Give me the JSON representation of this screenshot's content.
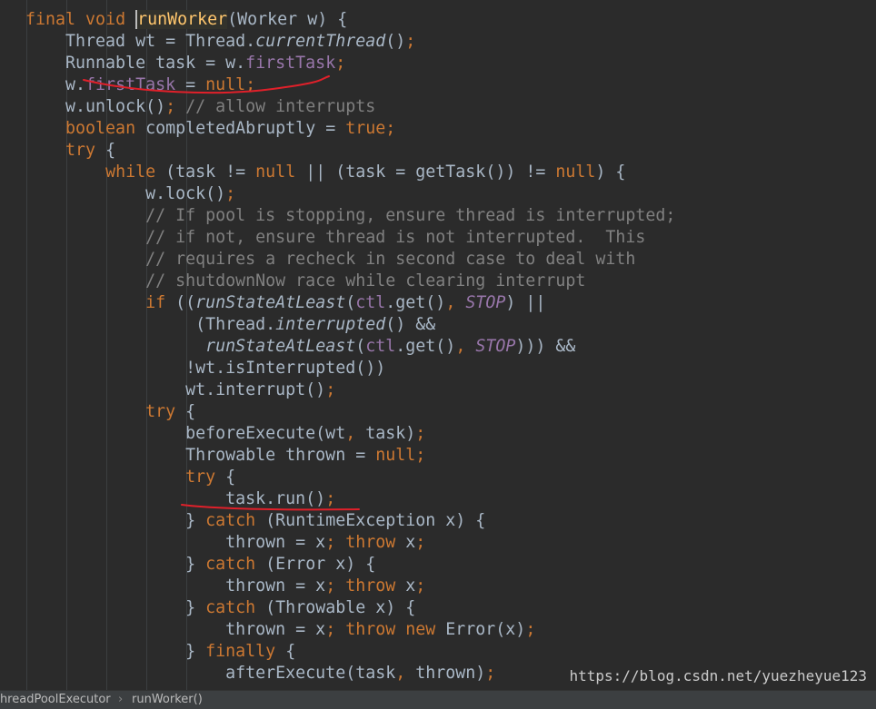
{
  "editor": {
    "code_lines": [
      [
        [
          "kw",
          "final "
        ],
        [
          "kw",
          "void "
        ],
        [
          "fn",
          "runWorker"
        ],
        [
          "t",
          "(Worker w) {"
        ]
      ],
      [
        [
          "t",
          "    Thread wt = Thread."
        ],
        [
          "it",
          "currentThread"
        ],
        [
          "t",
          "()"
        ],
        [
          "kw",
          ";"
        ]
      ],
      [
        [
          "t",
          "    Runnable task = w."
        ],
        [
          "fld",
          "firstTask"
        ],
        [
          "kw",
          ";"
        ]
      ],
      [
        [
          "t",
          "    w."
        ],
        [
          "fld",
          "firstTask"
        ],
        [
          "t",
          " = "
        ],
        [
          "kw",
          "null;"
        ]
      ],
      [
        [
          "t",
          "    w.unlock()"
        ],
        [
          "kw",
          ";"
        ],
        [
          "cmt",
          " // allow interrupts"
        ]
      ],
      [
        [
          "t",
          "    "
        ],
        [
          "kw",
          "boolean "
        ],
        [
          "t",
          "completedAbruptly = "
        ],
        [
          "kw",
          "true;"
        ]
      ],
      [
        [
          "t",
          "    "
        ],
        [
          "kw",
          "try "
        ],
        [
          "t",
          "{"
        ]
      ],
      [
        [
          "t",
          "        "
        ],
        [
          "kw",
          "while "
        ],
        [
          "t",
          "(task != "
        ],
        [
          "kw",
          "null "
        ],
        [
          "t",
          "|| (task = getTask()) != "
        ],
        [
          "kw",
          "null"
        ],
        [
          "t",
          ") {"
        ]
      ],
      [
        [
          "t",
          "            w.lock()"
        ],
        [
          "kw",
          ";"
        ]
      ],
      [
        [
          "cmt",
          "            // If pool is stopping, ensure thread is interrupted;"
        ]
      ],
      [
        [
          "cmt",
          "            // if not, ensure thread is not interrupted.  This"
        ]
      ],
      [
        [
          "cmt",
          "            // requires a recheck in second case to deal with"
        ]
      ],
      [
        [
          "cmt",
          "            // shutdownNow race while clearing interrupt"
        ]
      ],
      [
        [
          "t",
          "            "
        ],
        [
          "kw",
          "if "
        ],
        [
          "t",
          "(("
        ],
        [
          "it",
          "runStateAtLeast"
        ],
        [
          "t",
          "("
        ],
        [
          "fld",
          "ctl"
        ],
        [
          "t",
          ".get()"
        ],
        [
          "kw",
          ", "
        ],
        [
          "cst",
          "STOP"
        ],
        [
          "t",
          ") ||"
        ]
      ],
      [
        [
          "t",
          "                 (Thread."
        ],
        [
          "it",
          "interrupted"
        ],
        [
          "t",
          "() &&"
        ]
      ],
      [
        [
          "t",
          "                  "
        ],
        [
          "it",
          "runStateAtLeast"
        ],
        [
          "t",
          "("
        ],
        [
          "fld",
          "ctl"
        ],
        [
          "t",
          ".get()"
        ],
        [
          "kw",
          ", "
        ],
        [
          "cst",
          "STOP"
        ],
        [
          "t",
          "))) &&"
        ]
      ],
      [
        [
          "t",
          "                !wt.isInterrupted())"
        ]
      ],
      [
        [
          "t",
          "                wt.interrupt()"
        ],
        [
          "kw",
          ";"
        ]
      ],
      [
        [
          "t",
          "            "
        ],
        [
          "kw",
          "try "
        ],
        [
          "t",
          "{"
        ]
      ],
      [
        [
          "t",
          "                beforeExecute(wt"
        ],
        [
          "kw",
          ", "
        ],
        [
          "t",
          "task)"
        ],
        [
          "kw",
          ";"
        ]
      ],
      [
        [
          "t",
          "                Throwable thrown = "
        ],
        [
          "kw",
          "null;"
        ]
      ],
      [
        [
          "t",
          "                "
        ],
        [
          "kw",
          "try "
        ],
        [
          "t",
          "{"
        ]
      ],
      [
        [
          "t",
          "                    task.run()"
        ],
        [
          "kw",
          ";"
        ]
      ],
      [
        [
          "t",
          "                } "
        ],
        [
          "kw",
          "catch "
        ],
        [
          "t",
          "(RuntimeException x) {"
        ]
      ],
      [
        [
          "t",
          "                    thrown = x"
        ],
        [
          "kw",
          "; throw "
        ],
        [
          "t",
          "x"
        ],
        [
          "kw",
          ";"
        ]
      ],
      [
        [
          "t",
          "                } "
        ],
        [
          "kw",
          "catch "
        ],
        [
          "t",
          "(Error x) {"
        ]
      ],
      [
        [
          "t",
          "                    thrown = x"
        ],
        [
          "kw",
          "; throw "
        ],
        [
          "t",
          "x"
        ],
        [
          "kw",
          ";"
        ]
      ],
      [
        [
          "t",
          "                } "
        ],
        [
          "kw",
          "catch "
        ],
        [
          "t",
          "(Throwable x) {"
        ]
      ],
      [
        [
          "t",
          "                    thrown = x"
        ],
        [
          "kw",
          "; throw new "
        ],
        [
          "t",
          "Error(x)"
        ],
        [
          "kw",
          ";"
        ]
      ],
      [
        [
          "t",
          "                } "
        ],
        [
          "kw",
          "finally "
        ],
        [
          "t",
          "{"
        ]
      ],
      [
        [
          "t",
          "                    afterExecute(task"
        ],
        [
          "kw",
          ", "
        ],
        [
          "t",
          "thrown)"
        ],
        [
          "kw",
          ";"
        ]
      ]
    ]
  },
  "colors": {
    "background": "#2b2b2b",
    "keyword": "#cc7832",
    "field": "#9876aa",
    "comment": "#808080",
    "method_decl": "#ffc66d",
    "text": "#a9b7c6",
    "annotation_ink": "#e0202a"
  },
  "statusbar": {
    "class_crumb": "ThreadPoolExecutor",
    "separator": "›",
    "method_crumb": "runWorker()"
  },
  "watermark": "https://blog.csdn.net/yuezheyue123"
}
